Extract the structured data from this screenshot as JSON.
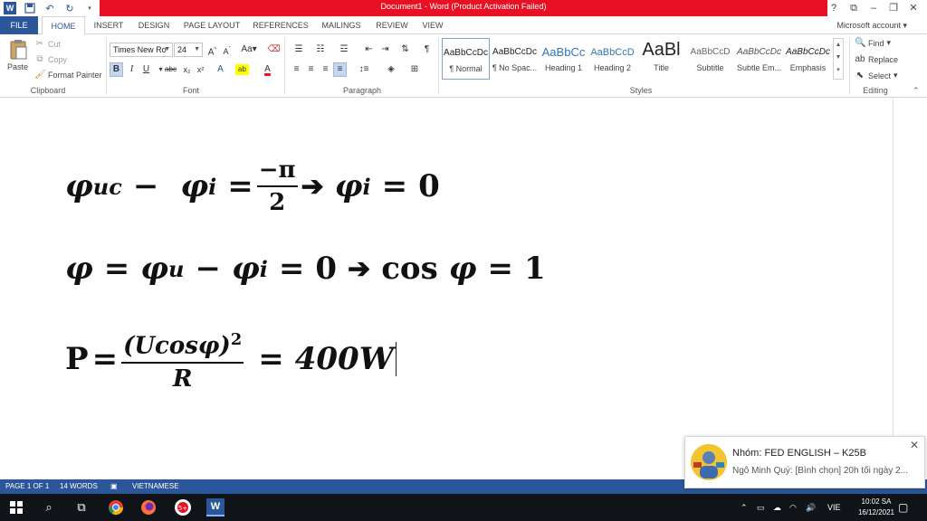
{
  "titlebar": {
    "title": "Document1 - Word (Product Activation Failed)",
    "window_buttons": [
      "?",
      "⧉",
      "–",
      "❐",
      "✕"
    ]
  },
  "tabs": [
    "FILE",
    "HOME",
    "INSERT",
    "DESIGN",
    "PAGE LAYOUT",
    "REFERENCES",
    "MAILINGS",
    "REVIEW",
    "VIEW"
  ],
  "account": "Microsoft account",
  "clipboard": {
    "paste": "Paste",
    "cut": "Cut",
    "copy": "Copy",
    "format_painter": "Format Painter",
    "label": "Clipboard"
  },
  "font": {
    "name": "Times New Ro",
    "size": "24",
    "label": "Font"
  },
  "paragraph": {
    "label": "Paragraph"
  },
  "styles": {
    "label": "Styles",
    "items": [
      {
        "preview": "AaBbCcDc",
        "name": "¶ Normal"
      },
      {
        "preview": "AaBbCcDc",
        "name": "¶ No Spac..."
      },
      {
        "preview": "AaBbCc",
        "name": "Heading 1"
      },
      {
        "preview": "AaBbCcD",
        "name": "Heading 2"
      },
      {
        "preview": "AaBl",
        "name": "Title"
      },
      {
        "preview": "AaBbCcD",
        "name": "Subtitle"
      },
      {
        "preview": "AaBbCcDc",
        "name": "Subtle Em..."
      },
      {
        "preview": "AaBbCcDc",
        "name": "Emphasis"
      }
    ]
  },
  "editing": {
    "find": "Find",
    "replace": "Replace",
    "select": "Select",
    "label": "Editing"
  },
  "document": {
    "eq1": {
      "lhs_a": "φ",
      "lhs_a_sub": "uc",
      "minus": "−",
      "lhs_b": "φ",
      "lhs_b_sub": "i",
      "eq": "=",
      "num": "−π",
      "den": "2",
      "arrow": "➔",
      "rhs": "φ",
      "rhs_sub": "i",
      "eq2": "=",
      "zero": "0"
    },
    "eq2": {
      "a": "φ",
      "eq": "=",
      "b": "φ",
      "b_sub": "u",
      "minus": "−",
      "c": "φ",
      "c_sub": "i",
      "eq2": "=",
      "zero": "0",
      "arrow": "➔",
      "cos": "cos",
      "phi": "φ",
      "eq3": "=",
      "one": "1"
    },
    "eq3": {
      "P": "P",
      "eq": "=",
      "num": "(Ucosφ)",
      "num_exp": "2",
      "den": "R",
      "eq2": "=",
      "result": "400W"
    }
  },
  "status": {
    "page": "PAGE 1 OF 1",
    "words": "14 WORDS",
    "language": "VIETNAMESE"
  },
  "toast": {
    "title": "Nhóm: FED ENGLISH – K25B",
    "message": "Ngô Minh Quý: [Bình chọn] 20h tối ngày 2..."
  },
  "taskbar": {
    "lang": "VIE",
    "time": "10:02 SA",
    "date": "16/12/2021"
  }
}
